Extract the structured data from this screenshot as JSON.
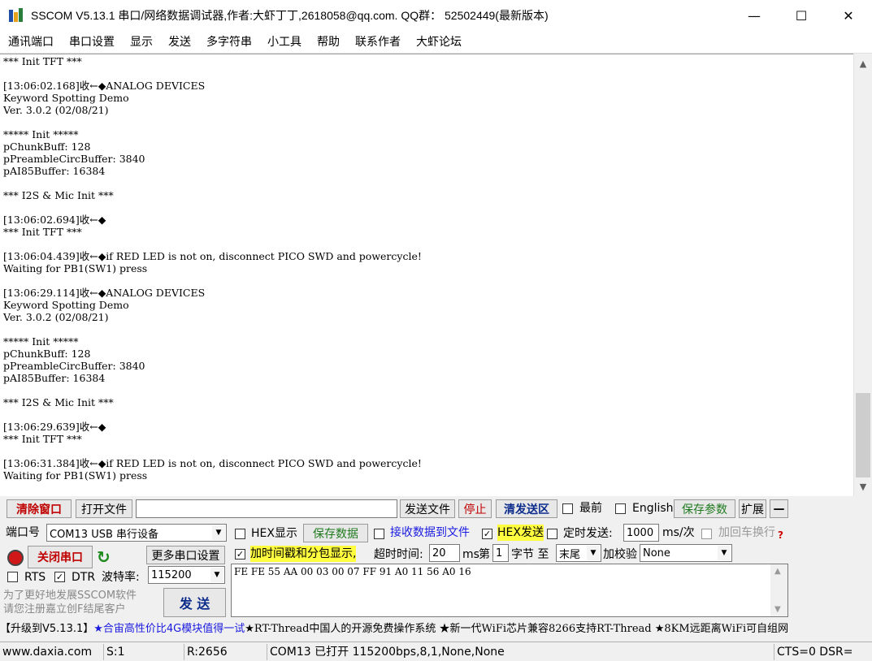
{
  "window": {
    "title": "SSCOM V5.13.1 串口/网络数据调试器,作者:大虾丁丁,2618058@qq.com. QQ群： 52502449(最新版本)",
    "minimize": "—",
    "maximize": "☐",
    "close": "✕"
  },
  "menu": [
    "通讯端口",
    "串口设置",
    "显示",
    "发送",
    "多字符串",
    "小工具",
    "帮助",
    "联系作者",
    "大虾论坛"
  ],
  "terminal": {
    "lines": [
      "*** Init TFT ***",
      "",
      "[13:06:02.168]收←◆ANALOG DEVICES",
      "Keyword Spotting Demo",
      "Ver. 3.0.2 (02/08/21)",
      "",
      "***** Init *****",
      "pChunkBuff: 128",
      "pPreambleCircBuffer: 3840",
      "pAI85Buffer: 16384",
      "",
      "*** I2S & Mic Init ***",
      "",
      "[13:06:02.694]收←◆",
      "*** Init TFT ***",
      "",
      "[13:06:04.439]收←◆if RED LED is not on, disconnect PICO SWD and powercycle!",
      "Waiting for PB1(SW1) press",
      "",
      "[13:06:29.114]收←◆ANALOG DEVICES",
      "Keyword Spotting Demo",
      "Ver. 3.0.2 (02/08/21)",
      "",
      "***** Init *****",
      "pChunkBuff: 128",
      "pPreambleCircBuffer: 3840",
      "pAI85Buffer: 16384",
      "",
      "*** I2S & Mic Init ***",
      "",
      "[13:06:29.639]收←◆",
      "*** Init TFT ***",
      "",
      "[13:06:31.384]收←◆if RED LED is not on, disconnect PICO SWD and powercycle!",
      "Waiting for PB1(SW1) press"
    ]
  },
  "toolbar": {
    "clear_window": "清除窗口",
    "open_file": "打开文件",
    "file_path": "",
    "send_file": "发送文件",
    "stop": "停止",
    "clear_send": "清发送区",
    "topmost": "最前",
    "english": "English",
    "save_params": "保存参数",
    "expand": "扩展",
    "collapse": "—"
  },
  "port": {
    "port_label": "端口号",
    "port_value": "COM13 USB 串行设备",
    "close_port": "关闭串口",
    "more_settings": "更多串口设置",
    "rts": "RTS",
    "dtr": "DTR",
    "baud_label": "波特率:",
    "baud_value": "115200",
    "promo_line1": "为了更好地发展SSCOM软件",
    "promo_line2": "请您注册嘉立创F结尾客户"
  },
  "options": {
    "hex_display": "HEX显示",
    "save_data": "保存数据",
    "recv_to_file": "接收数据到文件",
    "hex_send": "HEX发送",
    "timed_send": "定时发送:",
    "timed_value": "1000",
    "timed_unit": "ms/次",
    "add_crlf": "加回车换行",
    "help_mark": "?",
    "add_timestamp": "加时间戳和分包显示,",
    "timeout_label": "超时时间:",
    "timeout_value": "20",
    "timeout_unit": "ms",
    "nth_label": "第",
    "nth_value": "1",
    "byte_label": "字节 至",
    "end_value": "末尾",
    "checksum_label": "加校验",
    "checksum_value": "None"
  },
  "send": {
    "content": "FE FE 55 AA 00 03 00 07 FF 91 A0 11 56 A0 16",
    "send_button": "发  送"
  },
  "ticker": {
    "part1": "【升级到V5.13.1】",
    "part2": "★合宙高性价比4G模块值得一试",
    "part3": "★RT-Thread中国人的开源免费操作系统 ★新一代WiFi芯片兼容8266支持RT-Thread ★8KM远距离WiFi可自组网"
  },
  "status": {
    "website": "www.daxia.com",
    "sent": "S:1",
    "received": "R:2656",
    "port_state": "COM13 已打开  115200bps,8,1,None,None",
    "line_state": "CTS=0 DSR="
  }
}
